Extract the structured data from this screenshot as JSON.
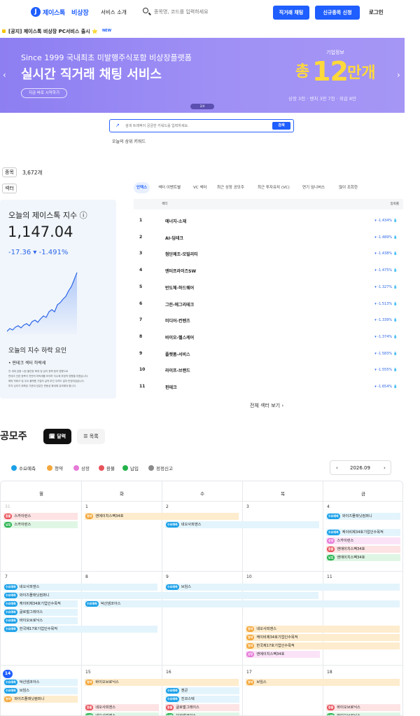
{
  "nav": {
    "logo_text": "제이스톡",
    "logo_sub": "비상장",
    "service_intro": "서비스 소개",
    "search_placeholder": "종목명, 코드를 입력하세요",
    "direct_chat_button": "직거래 채팅",
    "new_listing_button": "신규종목 신청",
    "login": "로그인"
  },
  "notice": {
    "text": "[공지] 제이스톡 비상장 PC서비스 출시 ⭐",
    "badge": "NEW"
  },
  "banner": {
    "since": "Since 1999 국내최초 미발행주식포함 비상장플랫폼",
    "title": "실시간 직거래 채팅 서비스",
    "cta": "지금 바로 시작하기",
    "info_label": "기업정보",
    "total_prefix": "총",
    "total_number": "12",
    "total_suffix": "만개",
    "detail": "상장 3천 · 벤처 3만 7천 · 외감 8만",
    "pager": "2/4",
    "prev": "‹",
    "next": "›"
  },
  "search_box": {
    "placeholder": "검색 트래픽이 궁금한 키워드를 입력하세요.",
    "button": "검색",
    "today_keywords": "오늘의 상위 키워드"
  },
  "stats": {
    "stocks_label": "종목",
    "stocks_count": "3,672개",
    "sector_label": "섹터"
  },
  "index_card": {
    "title": "오늘의 제이스톡 지수 ⓘ",
    "value": "1,147.04",
    "change": "-17.36 ▾ -1.491%",
    "reason_title": "오늘의 지수 하락 요인",
    "reason_bullet": "• 핀테크 섹터 하락세",
    "notes": [
      "전 세계 금융 시장 불안정 확대 및 금리 정책 등의 영향으로",
      "핀테크 관련 종목이 전반적 하락세를 보이며 지수에 부정적 영향을 미쳤습니다.",
      "해외 빅테크 및 주요 플랫폼 기업의 실적 부진 우려도 일부 반영되었습니다.",
      "투자 심리가 위축된 가운데 당분간 변동성 확대에 유의해야 합니다."
    ]
  },
  "sector_tabs": [
    "인덱스",
    "섹터 이벤트별",
    "VC 섹터",
    "최근 상장 공모주",
    "최근 투자유치 (VC)",
    "연기 임니버스",
    "많이 조회한"
  ],
  "sector_table": {
    "header_sector": "섹터",
    "header_change": "등락률",
    "rows": [
      {
        "rank": "1",
        "name": "에너지-소재",
        "change": "-1.434%"
      },
      {
        "rank": "2",
        "name": "AI-딥테크",
        "change": "-1.489%"
      },
      {
        "rank": "3",
        "name": "첨단제조-모빌리티",
        "change": "-1.438%"
      },
      {
        "rank": "4",
        "name": "엔터프라이즈SW",
        "change": "-1.475%"
      },
      {
        "rank": "5",
        "name": "반도체-하드웨어",
        "change": "-1.327%"
      },
      {
        "rank": "6",
        "name": "그린-에그리테크",
        "change": "-1.513%"
      },
      {
        "rank": "7",
        "name": "미디어-컨텐츠",
        "change": "-1.339%"
      },
      {
        "rank": "8",
        "name": "바이오-헬스케어",
        "change": "-1.374%"
      },
      {
        "rank": "9",
        "name": "플랫폼-서비스",
        "change": "-1.583%"
      },
      {
        "rank": "10",
        "name": "라이프-브랜드",
        "change": "-1.555%"
      },
      {
        "rank": "11",
        "name": "핀테크",
        "change": "-1.654%"
      }
    ],
    "more": "전체 섹터 보기 ›"
  },
  "ipo": {
    "title": "공모주",
    "calendar_toggle": "🗓 달력",
    "list_toggle": "☰ 목록",
    "legend": [
      {
        "label": "수요예측",
        "color": "#1aa0e8"
      },
      {
        "label": "청약",
        "color": "#f3a73b"
      },
      {
        "label": "상장",
        "color": "#e67ad8"
      },
      {
        "label": "환불",
        "color": "#e8525a"
      },
      {
        "label": "납입",
        "color": "#24b24b"
      },
      {
        "label": "정정신고",
        "color": "#8a8a8a"
      }
    ],
    "month": "2026.09",
    "prev": "‹",
    "next": "›",
    "weekdays": [
      "월",
      "화",
      "수",
      "목",
      "금"
    ],
    "days": {
      "w1": [
        "31",
        "1",
        "2",
        "3",
        "4"
      ],
      "w2": [
        "7",
        "8",
        "9",
        "10",
        "11"
      ],
      "w3": [
        "14",
        "15",
        "16",
        "17",
        "18"
      ]
    },
    "tags": {
      "demand": "수요예측",
      "sub": "청약",
      "list": "상장",
      "refund": "환불",
      "pay": "납입"
    },
    "events": {
      "w1_refund_skyimmune": "스카이런스",
      "w1_pay_skyimmune": "스카이런스",
      "w1_sub_nh34": "엔에이치스팩34호",
      "w1_demand_neo": "네오사피엔스",
      "w1_demand_wise": "와이즈플래닛컴퍼니",
      "w1_hanguk17": "케이비제34호기업인수목적",
      "w1_list_sky": "스카이런스",
      "w1_refund_nh": "엔에이치스팩34호",
      "w1_pay_nh": "엔에이치스팩34호",
      "w2_demand_neo": "네오사피엔스",
      "w2_demand_wise": "와이즈플래닛컴퍼니",
      "w2_kb34": "케이비제34호기업인수목적",
      "w2_demand_glo": "글로벌그레이스",
      "w2_demand_bio": "바이오브로닉스",
      "w2_demand_hk17": "한국제17호기업인수목적",
      "w2_demand_fasi": "덕산넴코아스",
      "w2_demand_brus": "브임스",
      "w2_sub_neo": "네오사피엔스",
      "w2_sub_kb": "케이비제34호기업인수목적",
      "w2_sub_hk": "한국제17호기업인수목적",
      "w2_list_nh": "엔에이치스팩34호",
      "w3_demand_duk": "덕산넴코아스",
      "w3_demand_brus": "브임스",
      "w3_sub_wise": "와이즈플래닛컴퍼니",
      "w3_sub_bio": "바이오브로닉스",
      "w3_demand_zen": "젠큰",
      "w3_demand_jin": "진코스텍",
      "w3_sub_brus": "브임스",
      "w3_refund_neo": "네오사피엔스",
      "w3_pay_neo": "네오사피엔스",
      "w3_refund_glo": "글로벌그레이스",
      "w3_pay_duk": "덕산넴코아스",
      "w3_refund_bio": "바이오브로닉스",
      "w3_pay_bio": "바이오브로닉스"
    }
  }
}
